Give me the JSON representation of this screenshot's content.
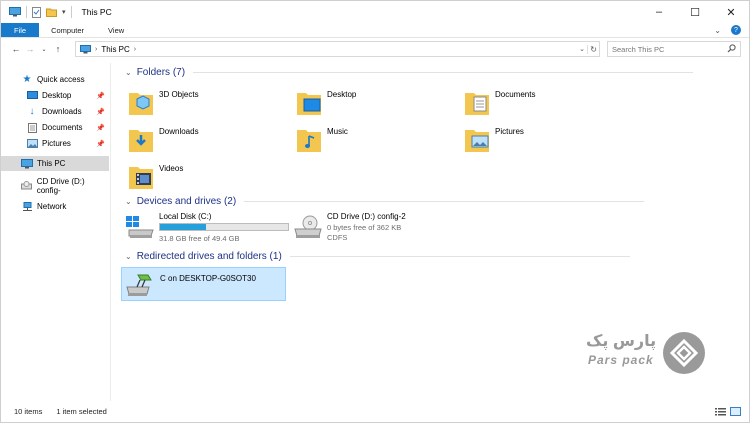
{
  "titlebar": {
    "title": "This PC",
    "controls": [
      "minimize",
      "maximize",
      "close"
    ]
  },
  "ribbon": {
    "tabs": [
      "File",
      "Computer",
      "View"
    ]
  },
  "address": {
    "crumb": "This PC",
    "search_placeholder": "Search This PC"
  },
  "nav": {
    "quick_access": "Quick access",
    "items": [
      {
        "label": "Desktop",
        "pinned": true
      },
      {
        "label": "Downloads",
        "pinned": true
      },
      {
        "label": "Documents",
        "pinned": true
      },
      {
        "label": "Pictures",
        "pinned": true
      }
    ],
    "this_pc": "This PC",
    "cd_drive": "CD Drive (D:) config-",
    "network": "Network"
  },
  "groups": {
    "folders": "Folders (7)",
    "devices": "Devices and drives (2)",
    "redirected": "Redirected drives and folders (1)"
  },
  "folders": [
    "3D Objects",
    "Desktop",
    "Documents",
    "Downloads",
    "Music",
    "Pictures",
    "Videos"
  ],
  "drives": [
    {
      "name": "Local Disk (C:)",
      "free": "31.8 GB free of 49.4 GB",
      "used_fraction": 0.36
    },
    {
      "name": "CD Drive (D:) config-2",
      "free": "0 bytes free of 362 KB",
      "fs": "CDFS"
    }
  ],
  "redirected": {
    "name": "C on DESKTOP-G0SOT30"
  },
  "status": {
    "items": "10 items",
    "selected": "1 item selected"
  },
  "watermark": {
    "fa": "پارس پک",
    "en": "Pars pack"
  },
  "colors": {
    "accent": "#1979ca",
    "group_header": "#1e3287",
    "selection": "#cce8ff",
    "drive_bar": "#26a0da",
    "folder": "#f3c74f"
  }
}
